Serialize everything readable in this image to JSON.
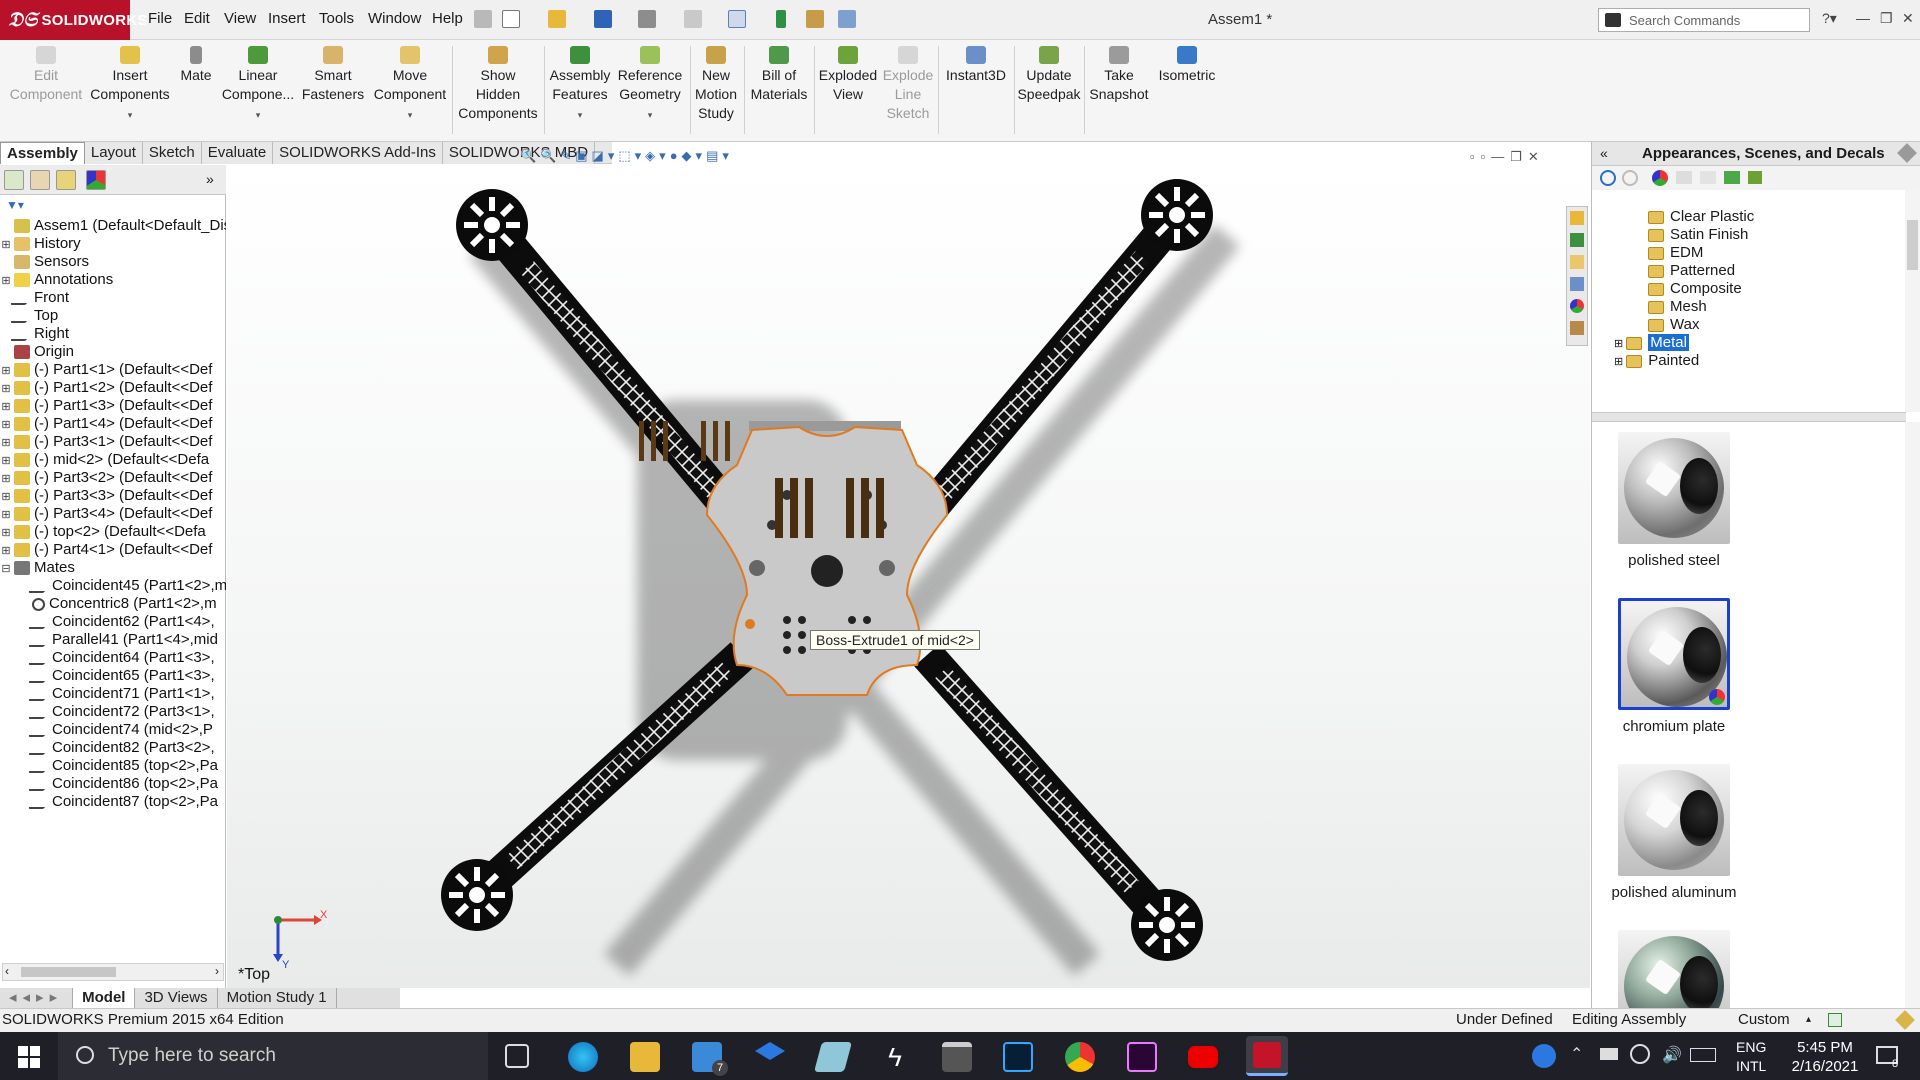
{
  "app": {
    "brand": "SOLIDWORKS",
    "document_title": "Assem1 *"
  },
  "menu": [
    "File",
    "Edit",
    "View",
    "Insert",
    "Tools",
    "Window",
    "Help"
  ],
  "search": {
    "placeholder": "Search Commands"
  },
  "ribbon": [
    {
      "label": "Edit\nComponent",
      "disabled": true
    },
    {
      "label": "Insert\nComponents"
    },
    {
      "label": "Mate"
    },
    {
      "label": "Linear\nCompone..."
    },
    {
      "label": "Smart\nFasteners"
    },
    {
      "label": "Move\nComponent"
    },
    {
      "label": "Show\nHidden\nComponents"
    },
    {
      "label": "Assembly\nFeatures"
    },
    {
      "label": "Reference\nGeometry"
    },
    {
      "label": "New\nMotion\nStudy"
    },
    {
      "label": "Bill of\nMaterials"
    },
    {
      "label": "Exploded\nView"
    },
    {
      "label": "Explode\nLine\nSketch",
      "disabled": true
    },
    {
      "label": "Instant3D"
    },
    {
      "label": "Update\nSpeedpak"
    },
    {
      "label": "Take\nSnapshot"
    },
    {
      "label": "Isometric"
    }
  ],
  "command_tabs": [
    "Assembly",
    "Layout",
    "Sketch",
    "Evaluate",
    "SOLIDWORKS Add-Ins",
    "SOLIDWORKS MBD"
  ],
  "feature_tree": [
    {
      "label": "Assem1  (Default<Default_Dis",
      "icon": "assembly-icon"
    },
    {
      "label": "History",
      "icon": "history-icon",
      "expander": "+"
    },
    {
      "label": "Sensors",
      "icon": "sensors-icon"
    },
    {
      "label": "Annotations",
      "icon": "annotations-icon",
      "expander": "+"
    },
    {
      "label": "Front",
      "icon": "plane-icon"
    },
    {
      "label": "Top",
      "icon": "plane-icon"
    },
    {
      "label": "Right",
      "icon": "plane-icon"
    },
    {
      "label": "Origin",
      "icon": "origin-icon"
    },
    {
      "label": "(-) Part1<1> (Default<<Def",
      "icon": "part-icon",
      "expander": "+"
    },
    {
      "label": "(-) Part1<2> (Default<<Def",
      "icon": "part-icon",
      "expander": "+"
    },
    {
      "label": "(-) Part1<3> (Default<<Def",
      "icon": "part-icon",
      "expander": "+"
    },
    {
      "label": "(-) Part1<4> (Default<<Def",
      "icon": "part-icon",
      "expander": "+"
    },
    {
      "label": "(-) Part3<1> (Default<<Def",
      "icon": "part-icon",
      "expander": "+"
    },
    {
      "label": "(-) mid<2> (Default<<Defa",
      "icon": "part-icon",
      "expander": "+"
    },
    {
      "label": "(-) Part3<2> (Default<<Def",
      "icon": "part-icon",
      "expander": "+"
    },
    {
      "label": "(-) Part3<3> (Default<<Def",
      "icon": "part-icon",
      "expander": "+"
    },
    {
      "label": "(-) Part3<4> (Default<<Def",
      "icon": "part-icon",
      "expander": "+"
    },
    {
      "label": "(-) top<2> (Default<<Defa",
      "icon": "part-icon",
      "expander": "+"
    },
    {
      "label": "(-) Part4<1> (Default<<Def",
      "icon": "part-icon",
      "expander": "+"
    },
    {
      "label": "Mates",
      "icon": "mates-icon",
      "expander": "-"
    },
    {
      "label": "Coincident45 (Part1<2>,m",
      "icon": "coincident-icon",
      "indent": true
    },
    {
      "label": "Concentric8 (Part1<2>,m",
      "icon": "concentric-icon",
      "indent": true
    },
    {
      "label": "Coincident62 (Part1<4>,",
      "icon": "coincident-icon",
      "indent": true
    },
    {
      "label": "Parallel41 (Part1<4>,mid",
      "icon": "parallel-icon",
      "indent": true
    },
    {
      "label": "Coincident64 (Part1<3>,",
      "icon": "coincident-icon",
      "indent": true
    },
    {
      "label": "Coincident65 (Part1<3>,",
      "icon": "coincident-icon",
      "indent": true
    },
    {
      "label": "Coincident71 (Part1<1>,",
      "icon": "coincident-icon",
      "indent": true
    },
    {
      "label": "Coincident72 (Part3<1>,",
      "icon": "coincident-icon",
      "indent": true
    },
    {
      "label": "Coincident74 (mid<2>,P",
      "icon": "coincident-icon",
      "indent": true
    },
    {
      "label": "Coincident82 (Part3<2>,",
      "icon": "coincident-icon",
      "indent": true
    },
    {
      "label": "Coincident85 (top<2>,Pa",
      "icon": "coincident-icon",
      "indent": true
    },
    {
      "label": "Coincident86 (top<2>,Pa",
      "icon": "coincident-icon",
      "indent": true
    },
    {
      "label": "Coincident87 (top<2>,Pa",
      "icon": "coincident-icon",
      "indent": true
    }
  ],
  "bottom_tabs": [
    "Model",
    "3D Views",
    "Motion Study 1"
  ],
  "viewport": {
    "tooltip": "Boss-Extrude1 of mid<2>",
    "view_name": "*Top",
    "triad_x": "X",
    "triad_y": "Y"
  },
  "right_panel": {
    "title": "Appearances, Scenes, and Decals",
    "tree": [
      {
        "label": "Clear Plastic"
      },
      {
        "label": "Satin Finish"
      },
      {
        "label": "EDM"
      },
      {
        "label": "Patterned"
      },
      {
        "label": "Composite"
      },
      {
        "label": "Mesh"
      },
      {
        "label": "Wax"
      },
      {
        "label": "Metal",
        "selected": true,
        "expander": "+"
      },
      {
        "label": "Painted",
        "expander": "+"
      }
    ],
    "swatches": [
      {
        "label": "polished steel"
      },
      {
        "label": "chromium plate",
        "selected": true
      },
      {
        "label": "polished aluminum"
      },
      {
        "label": ""
      }
    ]
  },
  "status": {
    "edition": "SOLIDWORKS Premium 2015 x64 Edition",
    "state": "Under Defined",
    "mode": "Editing Assembly",
    "units": "Custom"
  },
  "taskbar": {
    "search_placeholder": "Type here to search",
    "lang1": "ENG",
    "lang2": "INTL",
    "time": "5:45 PM",
    "date": "2/16/2021",
    "mail_badge": "7",
    "notif_badge": "8"
  },
  "colors": {
    "brand": "#b8112a",
    "selection": "#1a6fd1",
    "taskbar": "#1f1f28",
    "plate": "#c8c8c8",
    "frame": "#111111"
  }
}
